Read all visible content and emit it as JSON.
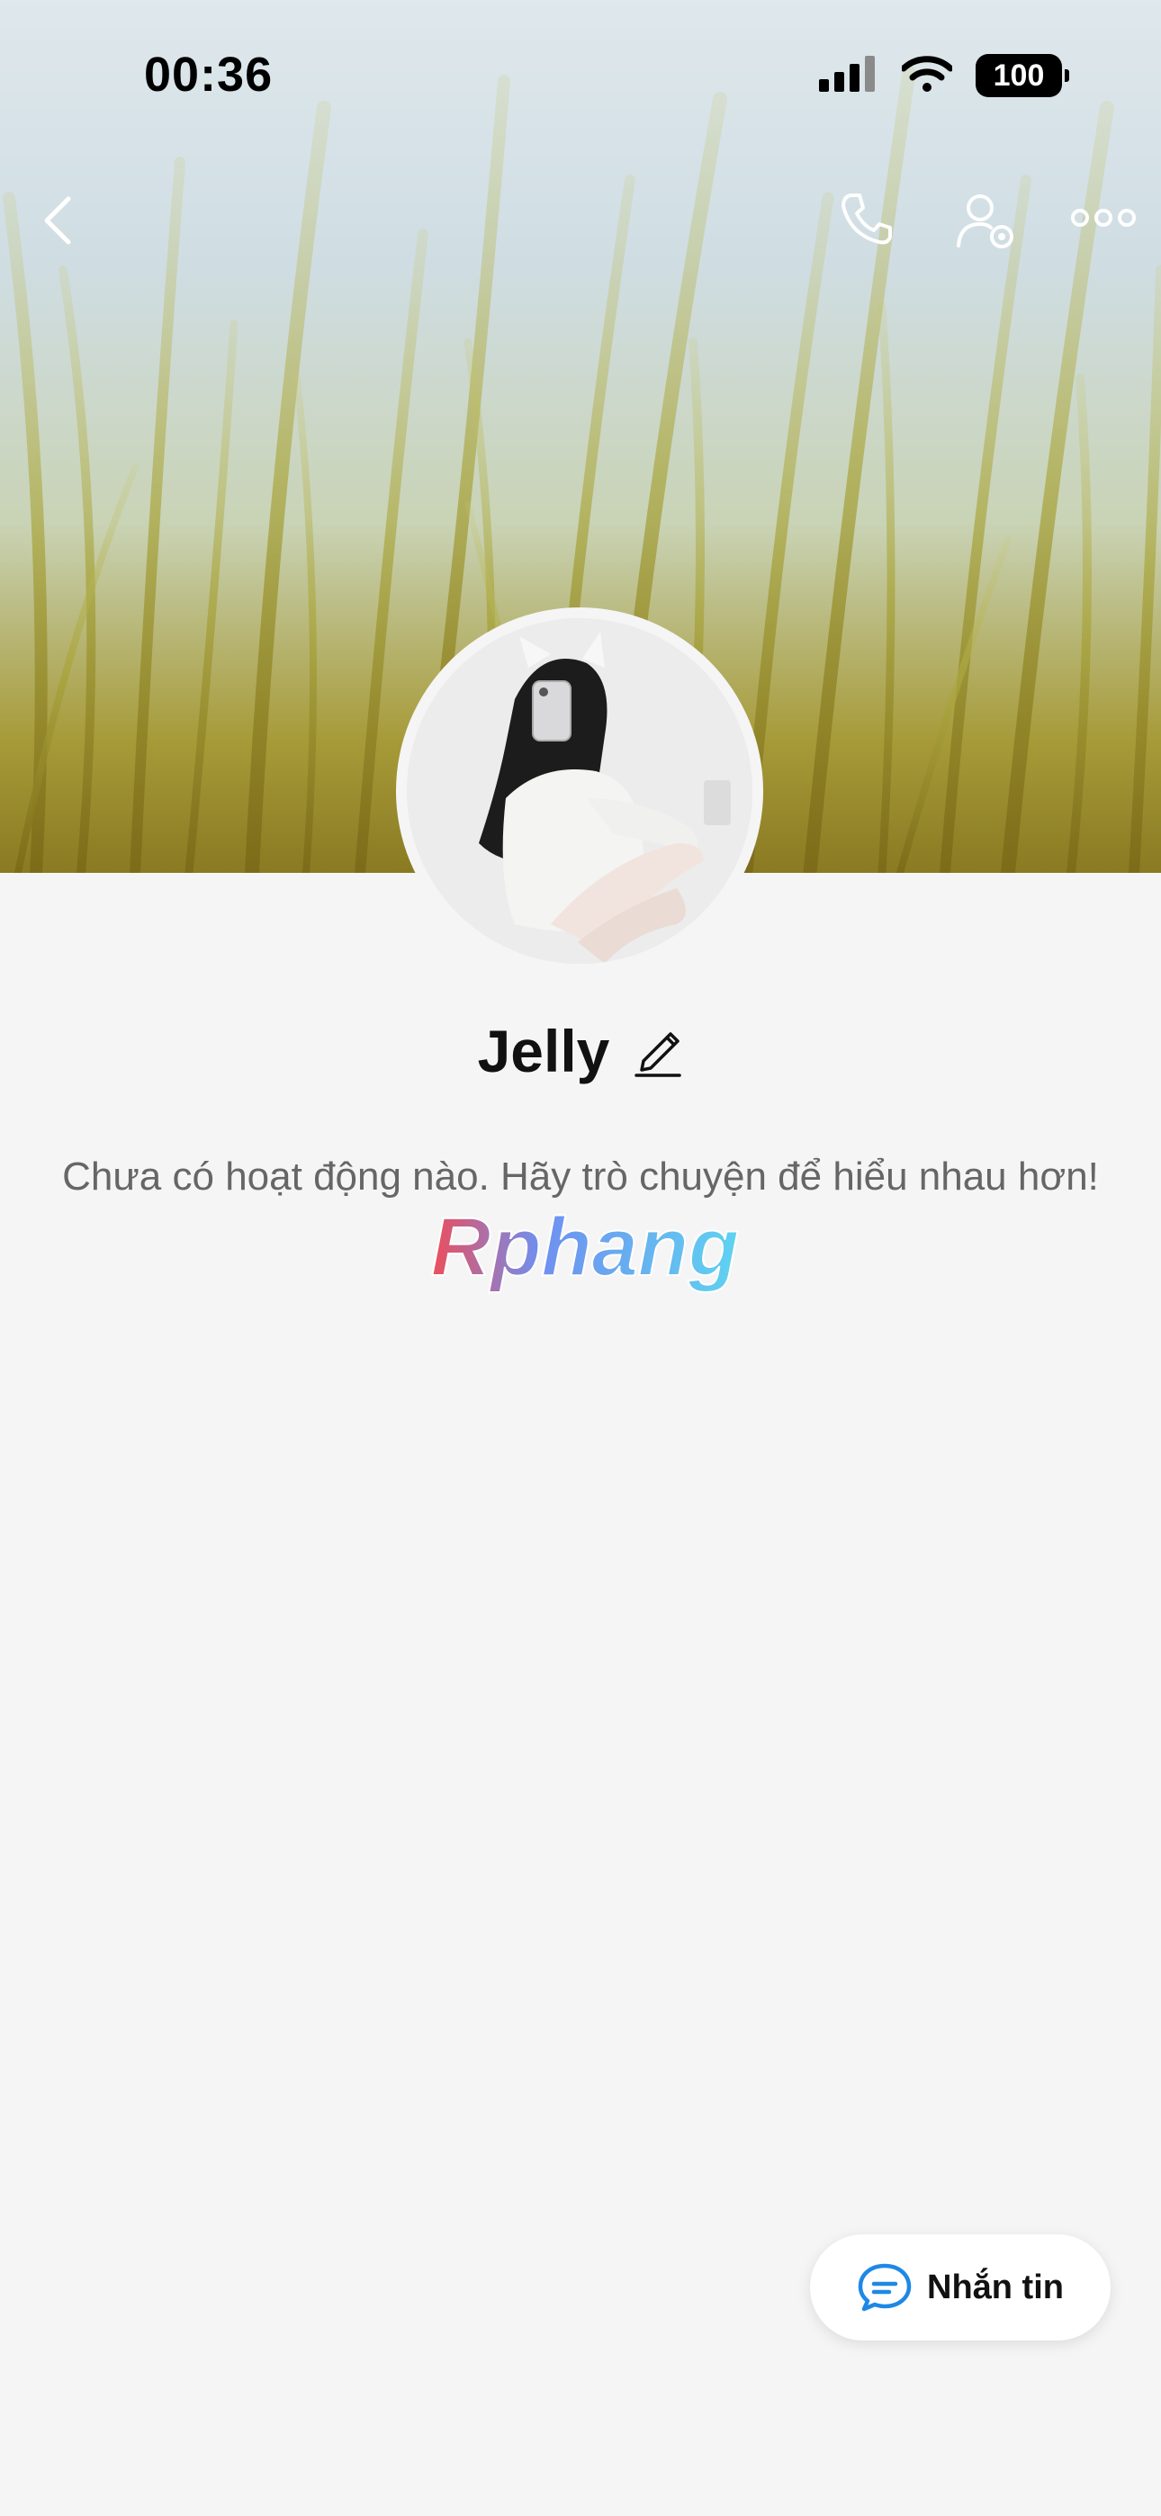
{
  "status_bar": {
    "time": "00:36",
    "battery": "100",
    "signal_icon": "signal-bars-icon",
    "wifi_icon": "wifi-icon"
  },
  "header": {
    "back_icon": "chevron-left-icon",
    "call_icon": "phone-icon",
    "settings_icon": "user-settings-icon",
    "more_icon": "more-dots-icon"
  },
  "profile": {
    "name": "Jelly",
    "edit_icon": "pencil-icon",
    "empty_activity_text": "Chưa có hoạt động nào. Hãy trò chuyện để hiểu nhau hơn!",
    "watermark": "Rphang"
  },
  "actions": {
    "message_label": "Nhắn tin",
    "message_icon": "chat-bubble-icon"
  },
  "colors": {
    "background": "#f5f5f5",
    "accent": "#1e88e5",
    "text_primary": "#111111",
    "text_secondary": "#666666"
  }
}
